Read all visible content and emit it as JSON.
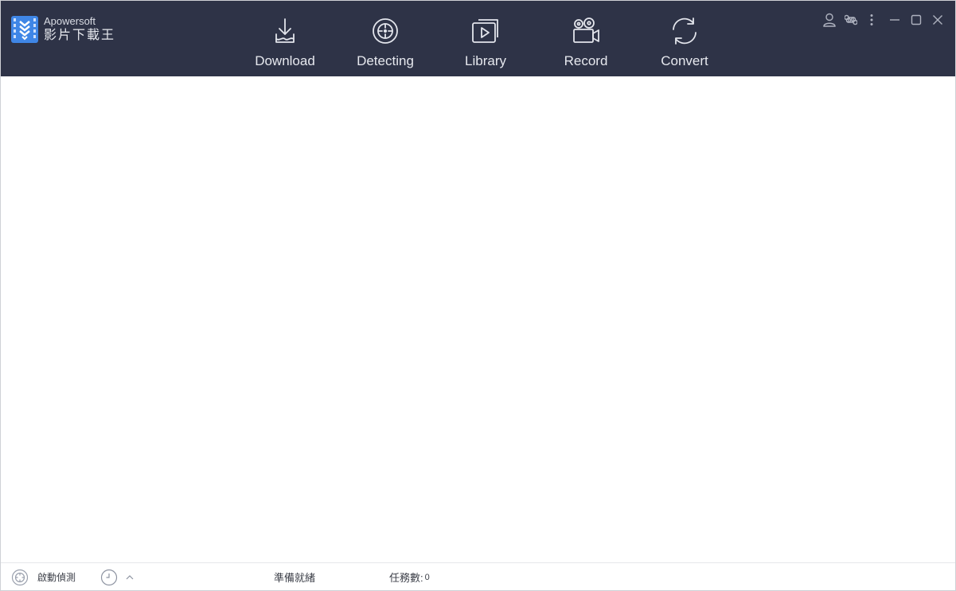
{
  "app": {
    "brand_en": "Apowersoft",
    "brand_zh": "影片下載王"
  },
  "nav": [
    {
      "label": "Download",
      "icon": "download-tray-icon"
    },
    {
      "label": "Detecting",
      "icon": "target-icon"
    },
    {
      "label": "Library",
      "icon": "video-library-icon"
    },
    {
      "label": "Record",
      "icon": "video-camera-icon"
    },
    {
      "label": "Convert",
      "icon": "convert-arrows-icon"
    }
  ],
  "window_controls": [
    "user-icon",
    "command-icon",
    "more-vertical-icon",
    "minimize-icon",
    "maximize-icon",
    "close-icon"
  ],
  "status": {
    "detect_label": "啟動偵測",
    "ready_text": "準備就緒",
    "tasks_label": "任務數:",
    "tasks_count": "0"
  },
  "colors": {
    "header_bg": "#2e3347",
    "header_text": "#e6e8ee",
    "logo_blue": "#3f86e6"
  }
}
